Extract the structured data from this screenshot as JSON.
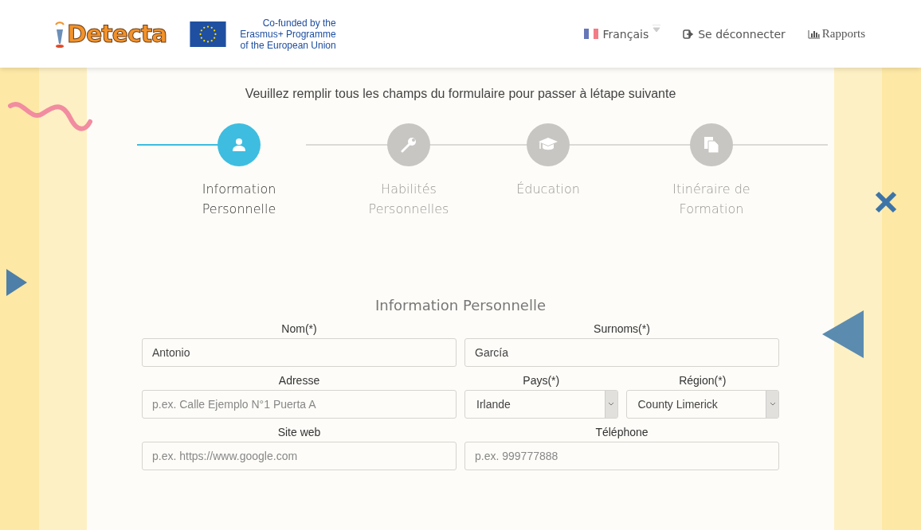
{
  "header": {
    "logo_text": "Detecta",
    "eu_text": [
      "Co-funded by the",
      "Erasmus+ Programme",
      "of the European Union"
    ],
    "nav": [
      {
        "kind": "language",
        "label": "Français"
      },
      {
        "kind": "logout",
        "label": "Se déconnecter"
      },
      {
        "kind": "reports",
        "label": "Rapports"
      }
    ]
  },
  "instruction": "Veuillez remplir tous les champs du formulaire pour passer à létape suivante",
  "steps": [
    {
      "label": [
        "Information",
        "Personnelle"
      ],
      "selected": true
    },
    {
      "label": [
        "Habilités",
        "Personnelles"
      ],
      "selected": false
    },
    {
      "label": [
        "Éducation"
      ],
      "selected": false
    },
    {
      "label": [
        "Itinéraire de",
        "Formation"
      ],
      "selected": false
    }
  ],
  "section_title": "Information Personnelle",
  "form": {
    "rows": [
      [
        {
          "label": "Nom(*)",
          "kind": "text",
          "value": "Antonio"
        },
        {
          "label": "Surnoms(*)",
          "kind": "text",
          "value": "García"
        }
      ],
      [
        {
          "label": "Adresse",
          "kind": "text",
          "placeholder": "p.ex. Calle Ejemplo N°1 Puerta A"
        },
        {
          "label": "Pays(*)",
          "kind": "select",
          "value": "Irlande"
        },
        {
          "label": "Région(*)",
          "kind": "select",
          "value": "County Limerick"
        }
      ],
      [
        {
          "label": "Site web",
          "kind": "text",
          "placeholder": "p.ex. https://www.google.com"
        },
        {
          "label": "Téléphone",
          "kind": "text",
          "placeholder": "p.ex. 999777888"
        }
      ]
    ]
  }
}
